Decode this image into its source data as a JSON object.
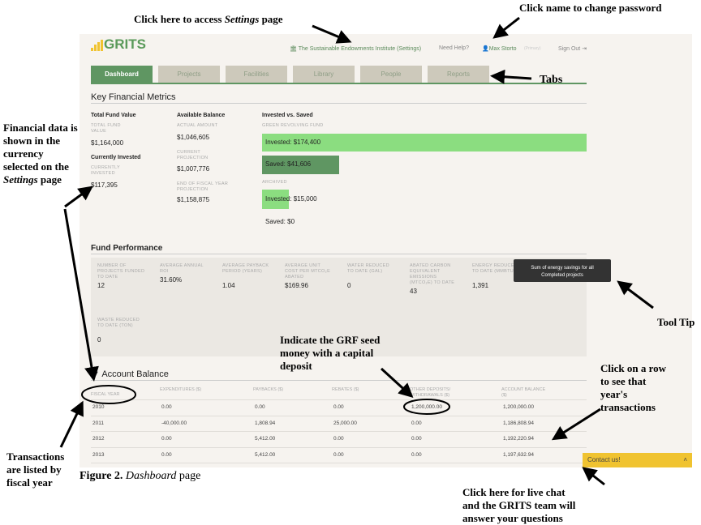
{
  "header": {
    "logo": "GRITS",
    "org_link": "The Sustainable Endowments Institute (Settings)",
    "help": "Need Help?",
    "user": "Max Storto",
    "role": "(Primary)",
    "sign_out": "Sign Out"
  },
  "tabs": [
    "Dashboard",
    "Projects",
    "Facilities",
    "Library",
    "People",
    "Reports"
  ],
  "kfm": {
    "title": "Key Financial Metrics",
    "total_fund": {
      "label": "Total Fund Value",
      "sub": "TOTAL FUND VALUE",
      "value": "$1,164,000"
    },
    "currently_invested": {
      "label": "Currently Invested",
      "sub": "CURRENTLY INVESTED",
      "value": "$117,395"
    },
    "available": {
      "label": "Available Balance",
      "actual_sub": "ACTUAL AMOUNT",
      "actual": "$1,046,605",
      "current_sub": "CURRENT PROJECTION",
      "current": "$1,007,776",
      "eoy_sub": "END OF FISCAL YEAR PROJECTION",
      "eoy": "$1,158,875"
    },
    "ivs": {
      "label": "Invested vs. Saved",
      "grf_sub": "GREEN REVOLVING FUND",
      "grf_invested": "Invested: $174,400",
      "grf_saved": "Saved: $41,606",
      "archived_sub": "ARCHIVED",
      "arch_invested": "Invested: $15,000",
      "arch_saved": "Saved: $0"
    }
  },
  "fund_performance": {
    "title": "Fund Performance",
    "metrics": [
      {
        "label": "NUMBER OF PROJECTS FUNDED TO DATE",
        "value": "12"
      },
      {
        "label": "AVERAGE ANNUAL ROI",
        "value": "31.60%"
      },
      {
        "label": "AVERAGE PAYBACK PERIOD (YEARS)",
        "value": "1.04"
      },
      {
        "label": "AVERAGE UNIT COST PER MTCO₂E ABATED",
        "value": "$169.96"
      },
      {
        "label": "WATER REDUCED TO DATE (GAL)",
        "value": "0"
      },
      {
        "label": "ABATED CARBON EQUIVALENT EMISSIONS (MTCO₂E) TO DATE",
        "value": "43"
      },
      {
        "label": "ENERGY REDUCED TO DATE (MMBTU)",
        "value": "1,391"
      },
      {
        "label": "WASTE REDUCED TO DATE (TON)",
        "value": "0"
      }
    ],
    "tooltip": "Sum of energy savings for all Completed projects"
  },
  "account_balance": {
    "title": "▼ Account Balance",
    "columns": [
      "FISCAL YEAR",
      "EXPENDITURES ($)",
      "PAYBACKS ($)",
      "REBATES ($)",
      "OTHER DEPOSITS/ WITHDRAWALS ($)",
      "ACCOUNT BALANCE ($)"
    ],
    "rows": [
      [
        "2010",
        "0.00",
        "0.00",
        "0.00",
        "1,200,000.00",
        "1,200,000.00"
      ],
      [
        "2011",
        "-40,000.00",
        "1,808.94",
        "25,000.00",
        "0.00",
        "1,186,808.94"
      ],
      [
        "2012",
        "0.00",
        "5,412.00",
        "0.00",
        "0.00",
        "1,192,220.94"
      ],
      [
        "2013",
        "0.00",
        "5,412.00",
        "0.00",
        "0.00",
        "1,197,632.94"
      ]
    ]
  },
  "contact": "Contact us!",
  "annotations": {
    "settings_a": "Click here to access ",
    "settings_b": "Settings",
    "settings_c": " page",
    "password": "Click name to change password",
    "tabs": "Tabs",
    "currency_a": "Financial data is shown in the currency selected on the ",
    "currency_b": "Settings",
    "currency_c": " page",
    "tooltip": "Tool Tip",
    "grf": "Indicate the GRF seed money with a capital deposit",
    "row": "Click on a row to see that year's transactions",
    "fiscal": "Transactions are listed by fiscal year",
    "chat": "Click here for live chat and the GRITS team will answer your questions"
  },
  "caption": {
    "fig": "Figure 2.",
    "name": "Dashboard",
    "rest": " page"
  },
  "colors": {
    "green": "#5f9662",
    "light_green": "#8bdd80",
    "tab_gray": "#cdc9bb",
    "yellow": "#f0c330",
    "tooltip": "#333333"
  }
}
